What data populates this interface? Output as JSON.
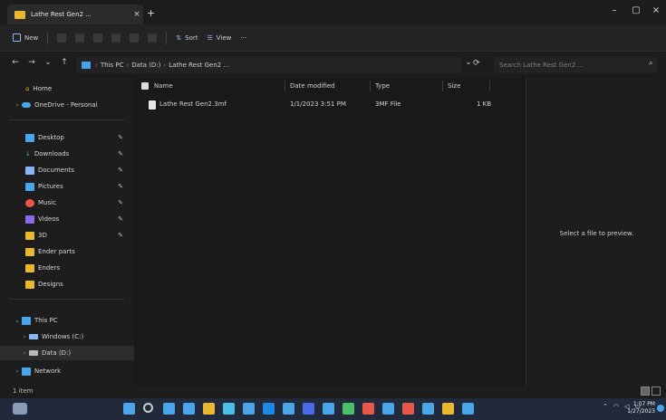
{
  "window": {
    "tab_title": "Lathe Rest Gen2 ...",
    "tab_close": "×",
    "new_tab": "+",
    "minimize": "–",
    "maximize": "▢",
    "close": "×"
  },
  "toolbar": {
    "new_label": "New",
    "sort_label": "Sort",
    "view_label": "View",
    "more": "···"
  },
  "address": {
    "path": [
      "This PC",
      "Data (D:)",
      "Lathe Rest Gen2 ..."
    ],
    "search_placeholder": "Search Lathe Rest Gen2 ..."
  },
  "sidebar": {
    "home": "Home",
    "onedrive": "OneDrive - Personal",
    "quick_access": [
      {
        "label": "Desktop",
        "color": "#4aa6e8"
      },
      {
        "label": "Downloads",
        "color": "#4ac06a"
      },
      {
        "label": "Documents",
        "color": "#8ab4f8"
      },
      {
        "label": "Pictures",
        "color": "#4aa6e8"
      },
      {
        "label": "Music",
        "color": "#e8584a"
      },
      {
        "label": "Videos",
        "color": "#8a6ae8"
      },
      {
        "label": "3D",
        "color": "#e8b830"
      },
      {
        "label": "Ender parts",
        "color": "#e8b830"
      },
      {
        "label": "Enders",
        "color": "#e8b830"
      },
      {
        "label": "Designs",
        "color": "#e8b830"
      }
    ],
    "this_pc": "This PC",
    "drives": [
      "Windows (C:)",
      "Data (D:)"
    ],
    "network": "Network"
  },
  "filelist": {
    "columns": [
      "Name",
      "Date modified",
      "Type",
      "Size"
    ],
    "rows": [
      {
        "name": "Lathe Rest Gen2.3mf",
        "date": "1/1/2023 3:51 PM",
        "type": "3MF File",
        "size": "1 KB"
      }
    ]
  },
  "preview": {
    "message": "Select a file to preview."
  },
  "status": {
    "items": "1 item"
  },
  "taskbar": {
    "time": "1:07 PM",
    "date": "1/27/2023",
    "tray_icons": [
      "chevron-up-icon",
      "wifi-icon",
      "volume-icon",
      "battery-icon"
    ],
    "app_colors": [
      "#4aa6e8",
      "#cccccc",
      "#4aa6e8",
      "#4aa6e8",
      "#e8b830",
      "#4ac0e8",
      "#4aa6e8",
      "#1e88e5",
      "#4aa6e8",
      "#4a6ae8",
      "#4aa6e8",
      "#4ac06a",
      "#e8584a",
      "#4aa6e8",
      "#e8584a",
      "#4aa6e8",
      "#e8b830",
      "#4aa6e8"
    ]
  }
}
